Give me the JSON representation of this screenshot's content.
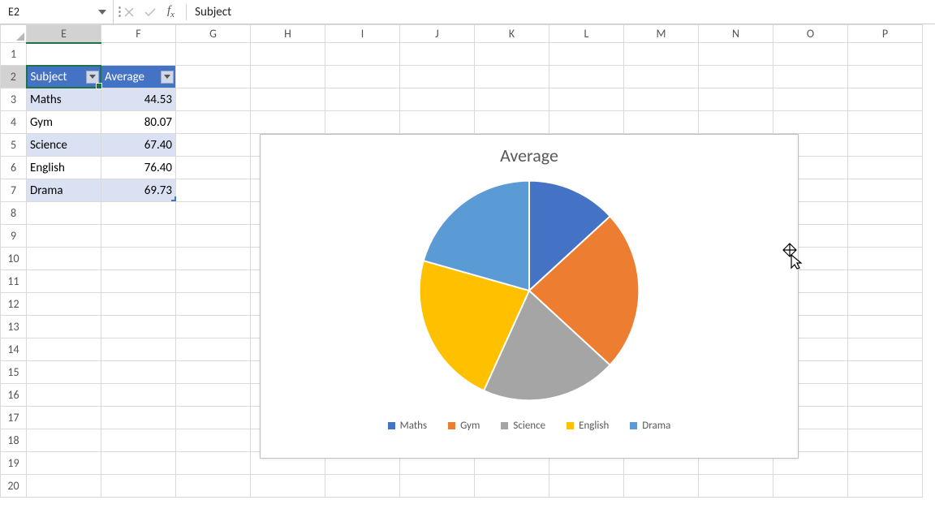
{
  "formula_bar": {
    "cell_ref": "E2",
    "formula": "Subject"
  },
  "columns": [
    "E",
    "F",
    "G",
    "H",
    "I",
    "J",
    "K",
    "L",
    "M",
    "N",
    "O",
    "P"
  ],
  "selected_col": "E",
  "selected_row": 2,
  "table": {
    "headers": [
      "Subject",
      "Average"
    ],
    "rows": [
      {
        "subject": "Maths",
        "average": "44.53"
      },
      {
        "subject": "Gym",
        "average": "80.07"
      },
      {
        "subject": "Science",
        "average": "67.40"
      },
      {
        "subject": "English",
        "average": "76.40"
      },
      {
        "subject": "Drama",
        "average": "69.73"
      }
    ]
  },
  "chart_data": {
    "type": "pie",
    "title": "Average",
    "categories": [
      "Maths",
      "Gym",
      "Science",
      "English",
      "Drama"
    ],
    "values": [
      44.53,
      80.07,
      67.4,
      76.4,
      69.73
    ],
    "colors": [
      "#4472C4",
      "#ED7D31",
      "#A5A5A5",
      "#FFC000",
      "#5B9BD5"
    ],
    "legend_position": "bottom"
  }
}
